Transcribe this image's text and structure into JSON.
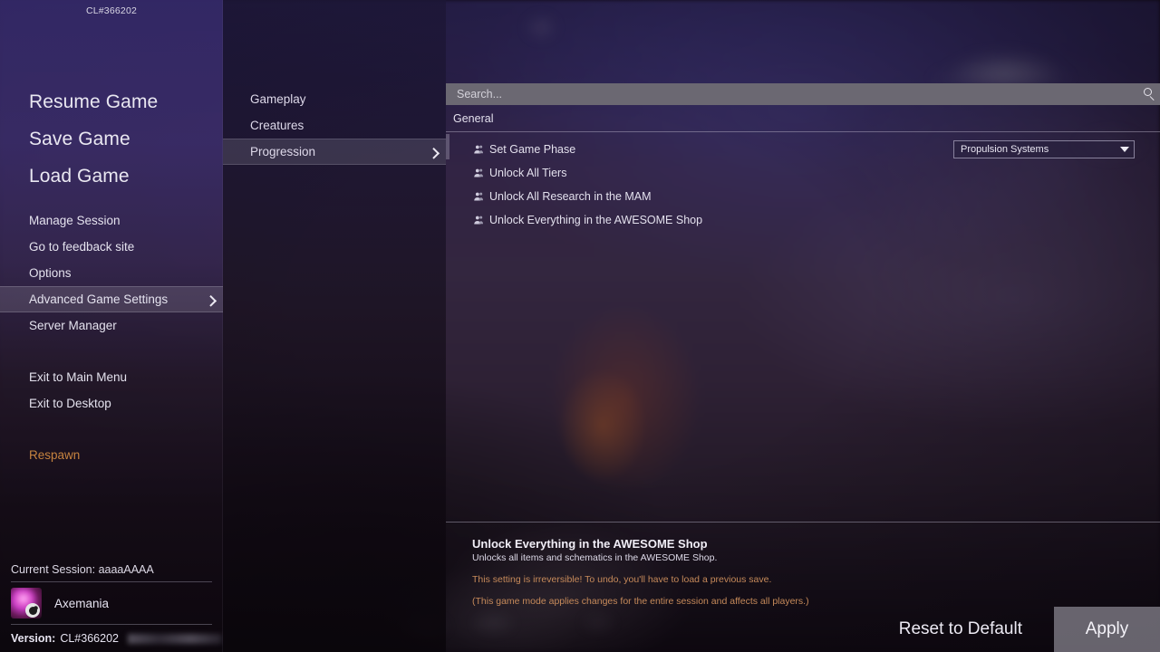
{
  "build_id": "CL#366202",
  "sidebar": {
    "primary_items": [
      {
        "label": "Resume Game",
        "size": "large"
      },
      {
        "label": "Save Game",
        "size": "large"
      },
      {
        "label": "Load Game",
        "size": "large"
      }
    ],
    "items": [
      {
        "label": "Manage Session",
        "active": false,
        "chevron": false
      },
      {
        "label": "Go to feedback site",
        "active": false,
        "chevron": false
      },
      {
        "label": "Options",
        "active": false,
        "chevron": false
      },
      {
        "label": "Advanced Game Settings",
        "active": true,
        "chevron": true
      },
      {
        "label": "Server Manager",
        "active": false,
        "chevron": false
      }
    ],
    "exit_items": [
      {
        "label": "Exit to Main Menu"
      },
      {
        "label": "Exit to Desktop"
      }
    ],
    "respawn_label": "Respawn",
    "session_label": "Current Session: aaaaAAAA",
    "player_name": "Axemania",
    "version_label": "Version:",
    "version_value": "CL#366202"
  },
  "subnav": {
    "items": [
      {
        "label": "Gameplay",
        "active": false,
        "chevron": false
      },
      {
        "label": "Creatures",
        "active": false,
        "chevron": false
      },
      {
        "label": "Progression",
        "active": true,
        "chevron": true
      }
    ]
  },
  "search": {
    "placeholder": "Search...",
    "value": "",
    "icon": "search-icon"
  },
  "main": {
    "section_title": "General",
    "settings": [
      {
        "label": "Set Game Phase",
        "icon": "multiplayer-icon",
        "control": "dropdown",
        "value": "Propulsion Systems"
      },
      {
        "label": "Unlock All Tiers",
        "icon": "multiplayer-icon",
        "control": "checkbox",
        "checked": true
      },
      {
        "label": "Unlock All Research in the MAM",
        "icon": "multiplayer-icon",
        "control": "checkbox",
        "checked": true
      },
      {
        "label": "Unlock Everything in the AWESOME Shop",
        "icon": "multiplayer-icon",
        "control": "checkbox",
        "checked": true
      }
    ]
  },
  "description": {
    "title": "Unlock Everything in the AWESOME Shop",
    "subtitle": "Unlocks all items and schematics in the AWESOME Shop.",
    "warning": "This setting is irreversible! To undo, you'll have to load a previous save.",
    "note": "(This game mode applies changes for the entire session and affects all players.)"
  },
  "footer": {
    "reset_label": "Reset to Default",
    "apply_label": "Apply"
  },
  "colors": {
    "accent_warning": "#c68a5a",
    "respawn": "#c6833f",
    "search_bg": "#6b6872",
    "highlight": "rgba(205,200,215,0.17)"
  }
}
